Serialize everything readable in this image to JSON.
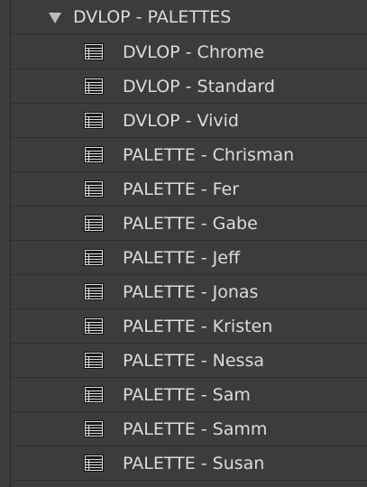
{
  "folder": {
    "label": "DVLOP - PALETTES",
    "expanded_icon": "triangle-down-icon"
  },
  "presets": [
    {
      "label": "DVLOP - Chrome",
      "icon": "preset-icon"
    },
    {
      "label": "DVLOP - Standard",
      "icon": "preset-icon"
    },
    {
      "label": "DVLOP - Vivid",
      "icon": "preset-icon"
    },
    {
      "label": "PALETTE - Chrisman",
      "icon": "preset-icon"
    },
    {
      "label": "PALETTE - Fer",
      "icon": "preset-icon"
    },
    {
      "label": "PALETTE - Gabe",
      "icon": "preset-icon"
    },
    {
      "label": "PALETTE - Jeff",
      "icon": "preset-icon"
    },
    {
      "label": "PALETTE - Jonas",
      "icon": "preset-icon"
    },
    {
      "label": "PALETTE - Kristen",
      "icon": "preset-icon"
    },
    {
      "label": "PALETTE - Nessa",
      "icon": "preset-icon"
    },
    {
      "label": "PALETTE - Sam",
      "icon": "preset-icon"
    },
    {
      "label": "PALETTE - Samm",
      "icon": "preset-icon"
    },
    {
      "label": "PALETTE - Susan",
      "icon": "preset-icon"
    }
  ],
  "colors": {
    "background": "#3c3c3c",
    "text": "#dcdcdc",
    "divider": "#2e2e2e"
  }
}
